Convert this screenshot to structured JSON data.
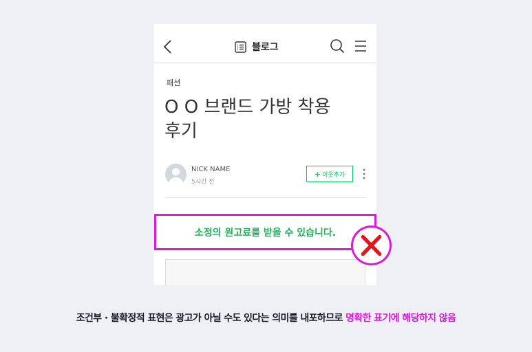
{
  "header": {
    "blog_label": "블로그",
    "icons": [
      "back-icon",
      "list-icon",
      "search-icon",
      "menu-icon"
    ]
  },
  "post": {
    "category": "패션",
    "title_line1": "O O 브랜드 가방 착용",
    "title_line2": "후기",
    "author_name": "NICK NAME",
    "time_ago": "5시간 전",
    "follow_label": "이웃추가",
    "follow_plus": "+"
  },
  "highlight": {
    "text": "소정의 원고료를 받을 수 있습니다."
  },
  "caption": {
    "main": "조건부 · 불확정적 표현은 광고가 아닐 수도 있다는 의미를 내포하므로 ",
    "accent": "명확한 표기에 해당하지 않음"
  },
  "colors": {
    "accent_magenta": "#d61cd6",
    "green": "#03c75a",
    "highlight_green": "#1fb25a",
    "x_red": "#e0161b",
    "background": "#eef0f5"
  }
}
